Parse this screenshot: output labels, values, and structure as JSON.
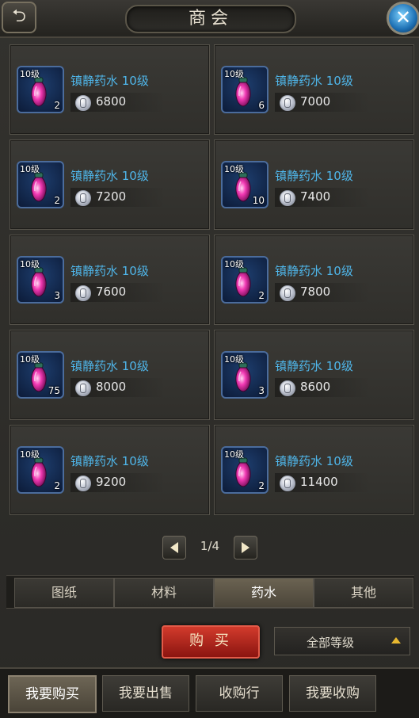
{
  "header": {
    "title": "商会",
    "back_icon": "back-arrow-icon",
    "close_icon": "close-icon",
    "accent_color": "#4fb6ea"
  },
  "listings": [
    {
      "level": "10级",
      "name": "镇静药水 10级",
      "price": "6800",
      "count": "2"
    },
    {
      "level": "10级",
      "name": "镇静药水 10级",
      "price": "7000",
      "count": "6"
    },
    {
      "level": "10级",
      "name": "镇静药水 10级",
      "price": "7200",
      "count": "2"
    },
    {
      "level": "10级",
      "name": "镇静药水 10级",
      "price": "7400",
      "count": "10"
    },
    {
      "level": "10级",
      "name": "镇静药水 10级",
      "price": "7600",
      "count": "3"
    },
    {
      "level": "10级",
      "name": "镇静药水 10级",
      "price": "7800",
      "count": "2"
    },
    {
      "level": "10级",
      "name": "镇静药水 10级",
      "price": "8000",
      "count": "75"
    },
    {
      "level": "10级",
      "name": "镇静药水 10级",
      "price": "8600",
      "count": "3"
    },
    {
      "level": "10级",
      "name": "镇静药水 10级",
      "price": "9200",
      "count": "2"
    },
    {
      "level": "10级",
      "name": "镇静药水 10级",
      "price": "11400",
      "count": "2"
    }
  ],
  "pagination": {
    "text": "1/4",
    "prev_icon": "prev-arrow-icon",
    "next_icon": "next-arrow-icon"
  },
  "categories": {
    "items": [
      "图纸",
      "材料",
      "药水",
      "其他"
    ],
    "selected": "药水"
  },
  "actions": {
    "buy_label": "购 买",
    "filter_value": "全部等级",
    "buy_color": "#c0281c"
  },
  "bottom_nav": {
    "items": [
      "我要购买",
      "我要出售",
      "收购行",
      "我要收购"
    ],
    "selected": "我要购买"
  }
}
